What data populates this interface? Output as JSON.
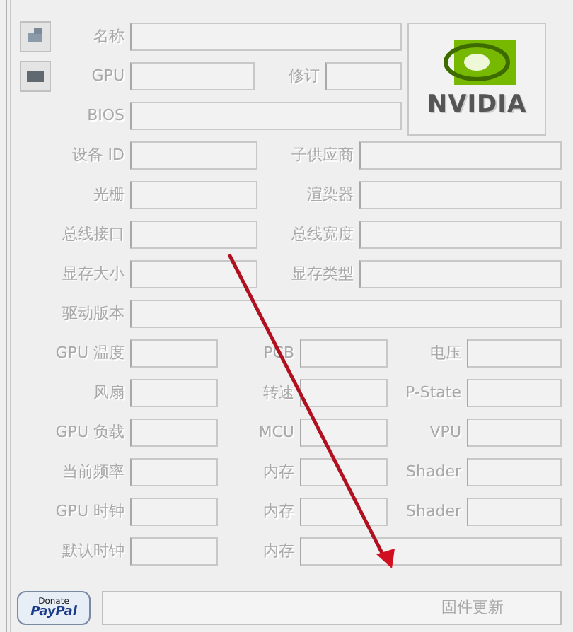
{
  "header": {
    "rows": [
      {
        "cells": [
          {
            "label": "名称"
          }
        ]
      },
      {
        "cells": [
          {
            "label": "GPU"
          },
          {
            "label": "修订"
          }
        ]
      },
      {
        "cells": [
          {
            "label": "BIOS"
          }
        ]
      }
    ],
    "logo_text": "NVIDIA"
  },
  "rows": [
    {
      "kind": "pair",
      "cells": [
        {
          "label": "设备 ID"
        },
        {
          "label": "子供应商"
        }
      ]
    },
    {
      "kind": "pair",
      "cells": [
        {
          "label": "光栅"
        },
        {
          "label": "渲染器"
        }
      ]
    },
    {
      "kind": "pair",
      "cells": [
        {
          "label": "总线接口"
        },
        {
          "label": "总线宽度"
        }
      ]
    },
    {
      "kind": "pair",
      "cells": [
        {
          "label": "显存大小"
        },
        {
          "label": "显存类型"
        }
      ]
    },
    {
      "kind": "single",
      "cells": [
        {
          "label": "驱动版本"
        }
      ]
    },
    {
      "kind": "triple",
      "cells": [
        {
          "label": "GPU 温度"
        },
        {
          "label": "PCB"
        },
        {
          "label": "电压"
        }
      ]
    },
    {
      "kind": "triple",
      "cells": [
        {
          "label": "风扇"
        },
        {
          "label": "转速"
        },
        {
          "label": "P-State"
        }
      ]
    },
    {
      "kind": "triple",
      "cells": [
        {
          "label": "GPU 负载"
        },
        {
          "label": "MCU"
        },
        {
          "label": "VPU"
        }
      ]
    },
    {
      "kind": "triple",
      "cells": [
        {
          "label": "当前频率"
        },
        {
          "label": "内存"
        },
        {
          "label": "Shader"
        }
      ]
    },
    {
      "kind": "triple",
      "cells": [
        {
          "label": "GPU 时钟"
        },
        {
          "label": "内存"
        },
        {
          "label": "Shader"
        }
      ]
    },
    {
      "kind": "double",
      "cells": [
        {
          "label": "默认时钟"
        },
        {
          "label": "内存"
        }
      ]
    }
  ],
  "footer": {
    "donate": "Donate",
    "paypal": "PayPal",
    "status": "固件更新"
  }
}
